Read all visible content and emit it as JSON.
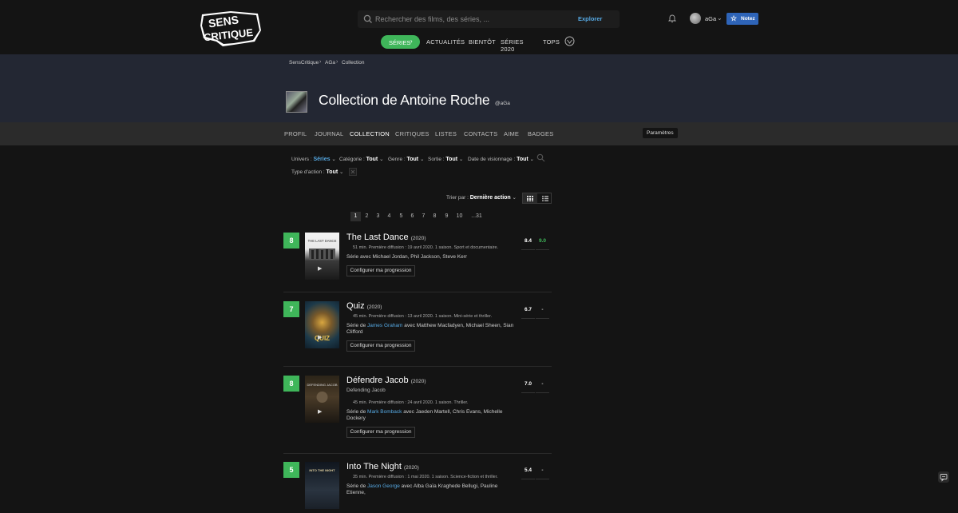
{
  "header": {
    "logo_text": [
      "SENS",
      "CRITIQUE"
    ],
    "search_placeholder": "Rechercher des films, des séries, ...",
    "explorer_label": "Explorer",
    "user_name": "aGa",
    "notez_label": "Notez"
  },
  "nav": {
    "active": "SÉRIES",
    "items": [
      "ACTUALITÉS",
      "BIENTÔT",
      "SÉRIES 2020",
      "TOPS"
    ]
  },
  "breadcrumb": [
    "SensCritique",
    "AGa",
    "Collection"
  ],
  "profile": {
    "title": "Collection de Antoine Roche",
    "handle": "@aGa"
  },
  "tabs": [
    "PROFIL",
    "JOURNAL",
    "COLLECTION",
    "CRITIQUES",
    "LISTES",
    "CONTACTS",
    "AIME",
    "BADGES"
  ],
  "active_tab": "COLLECTION",
  "settings_label": "Paramètres",
  "filters": {
    "univers": {
      "label": "Univers :",
      "value": "Séries"
    },
    "categorie": {
      "label": "Catégorie :",
      "value": "Tout"
    },
    "genre": {
      "label": "Genre :",
      "value": "Tout"
    },
    "sortie": {
      "label": "Sortie :",
      "value": "Tout"
    },
    "date": {
      "label": "Date de visionnage :",
      "value": "Tout"
    },
    "type": {
      "label": "Type d'action :",
      "value": "Tout"
    }
  },
  "sort": {
    "label": "Trier par :",
    "value": "Dernière action"
  },
  "pagination": {
    "current": "1",
    "pages": [
      "1",
      "2",
      "3",
      "4",
      "5",
      "6",
      "7",
      "8",
      "9",
      "10",
      "...31"
    ]
  },
  "items": [
    {
      "rating": "8",
      "title": "The Last Dance",
      "year": "(2020)",
      "original_title": "",
      "meta": "51 min. Première diffusion : 19 avril 2020. 1 saison. Sport et documentaire.",
      "cast_prefix": "Série avec Michael Jordan, Phil Jackson, Steve Kerr",
      "creator": "",
      "cast_suffix": "",
      "avg": "8.4",
      "friends": "9.0",
      "button": "Configurer ma progression",
      "poster_text": "THE LAST DANCE"
    },
    {
      "rating": "7",
      "title": "Quiz",
      "year": "(2020)",
      "original_title": "",
      "meta": "45 min. Première diffusion : 13 avril 2020. 1 saison. Mini-série et thriller.",
      "cast_prefix": "Série de ",
      "creator": "James Graham",
      "cast_suffix": " avec Matthew Macfadyen, Michael Sheen, Sian Clifford",
      "avg": "6.7",
      "friends": "-",
      "button": "Configurer ma progression",
      "poster_text": "QUIZ"
    },
    {
      "rating": "8",
      "title": "Défendre Jacob",
      "year": "(2020)",
      "original_title": "Defending Jacob",
      "meta": "45 min. Première diffusion : 24 avril 2020. 1 saison. Thriller.",
      "cast_prefix": "Série de ",
      "creator": "Mark Bomback",
      "cast_suffix": " avec Jaeden Martell, Chris Evans, Michelle Dockery",
      "avg": "7.0",
      "friends": "-",
      "button": "Configurer ma progression",
      "poster_text": "DEFENDING JACOB"
    },
    {
      "rating": "5",
      "title": "Into The Night",
      "year": "(2020)",
      "original_title": "",
      "meta": "35 min. Première diffusion : 1 mai 2020. 1 saison. Science-fiction et thriller.",
      "cast_prefix": "Série de ",
      "creator": "Jason George",
      "cast_suffix": " avec Alba Gaïa Kraghede Bellugi, Pauline Etienne,",
      "avg": "5.4",
      "friends": "-",
      "button": "",
      "poster_text": "INTO THE NIGHT"
    }
  ],
  "colors": {
    "accent_green": "#3fb65a",
    "link_blue": "#56a9e3",
    "notez_blue": "#2e64b8"
  }
}
